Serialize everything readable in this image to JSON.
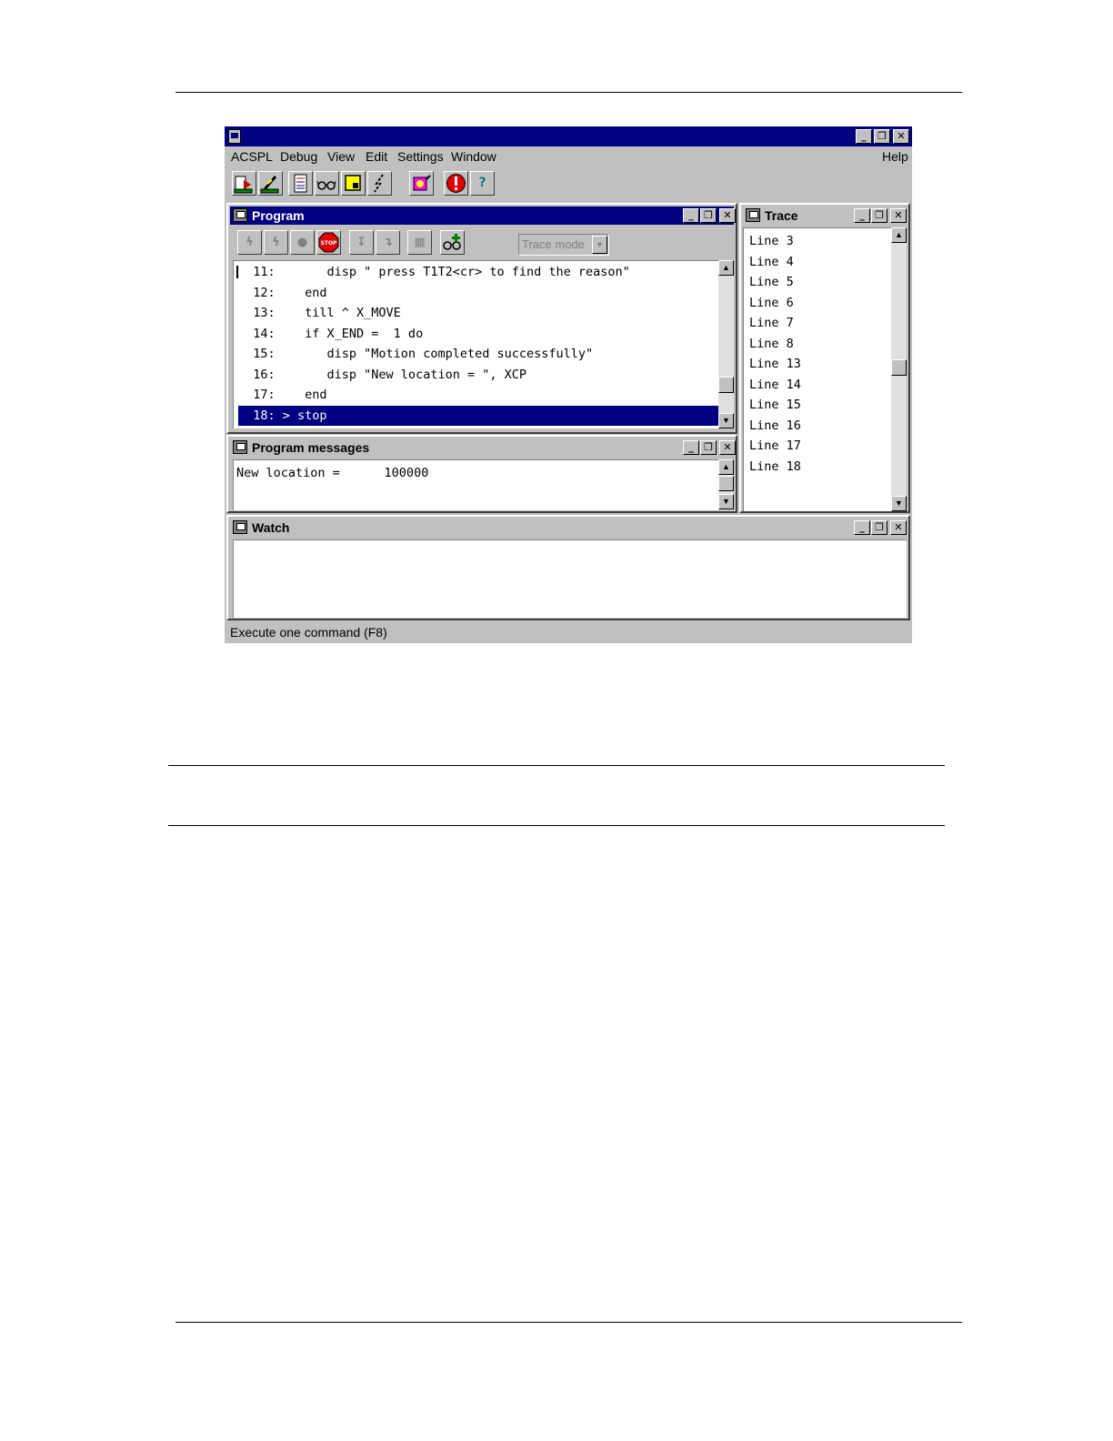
{
  "menu": {
    "acspl": "ACSPL",
    "debug": "Debug",
    "view": "View",
    "edit": "Edit",
    "settings": "Settings",
    "window": "Window",
    "help": "Help"
  },
  "window_controls": {
    "minimize": "_",
    "restore": "❐",
    "close": "✕"
  },
  "toolbar_icons": [
    "download-icon",
    "compile-icon",
    "calculator-icon",
    "watch-glasses-icon",
    "note-icon",
    "lightning-icon",
    "motor-icon",
    "emergency-stop-icon",
    "help-icon"
  ],
  "program": {
    "title": "Program",
    "trace_mode": "Trace mode",
    "lines": [
      {
        "text": "  11:       disp \" press T1T2<cr> to find the reason\"",
        "selected": false
      },
      {
        "text": "  12:    end",
        "selected": false
      },
      {
        "text": "  13:    till ^ X_MOVE",
        "selected": false
      },
      {
        "text": "  14:    if X_END =  1 do",
        "selected": false
      },
      {
        "text": "  15:       disp \"Motion completed successfully\"",
        "selected": false
      },
      {
        "text": "  16:       disp \"New location = \", XCP",
        "selected": false
      },
      {
        "text": "  17:    end",
        "selected": false
      },
      {
        "text": "  18: > stop",
        "selected": true
      }
    ]
  },
  "messages": {
    "title": "Program messages",
    "text": "New location =      100000"
  },
  "trace": {
    "title": "Trace",
    "lines": [
      "Line 3",
      "Line 4",
      "Line 5",
      "Line 6",
      "Line 7",
      "Line 8",
      "Line 13",
      "Line 14",
      "Line 15",
      "Line 16",
      "Line 17",
      "Line 18"
    ]
  },
  "watch": {
    "title": "Watch"
  },
  "status": "Execute one command (F8)"
}
